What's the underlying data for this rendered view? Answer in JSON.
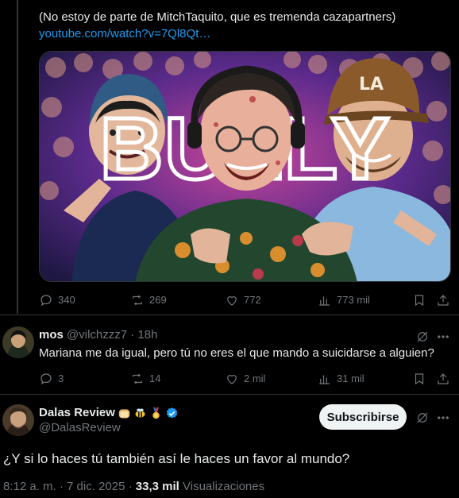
{
  "parent_tweet": {
    "text": "(No estoy de parte de MitchTaquito, que es tremenda cazapartners)",
    "link": "youtube.com/watch?v=7Ql8Qt…",
    "thumbnail_word": "BULLY",
    "actions": {
      "replies": "340",
      "retweets": "269",
      "likes": "772",
      "views": "773 mil"
    }
  },
  "reply": {
    "name": "mos",
    "handle": "@vilchzzz7",
    "separator": "·",
    "time": "18h",
    "text": "Mariana me da igual, pero tú no eres el que mando a suicidarse a alguien?",
    "actions": {
      "replies": "3",
      "retweets": "14",
      "likes": "2 mil",
      "views": "31 mil"
    }
  },
  "main_tweet": {
    "name": "Dalas Review",
    "emoji_badges": [
      "bread-emoji",
      "bee-emoji",
      "medal-emoji"
    ],
    "verified": true,
    "handle": "@DalasReview",
    "subscribe_label": "Subscribirse",
    "text": "¿Y si lo haces tú también así le haces un favor al mundo?",
    "time": "8:12 a. m.",
    "date": "7 dic. 2025",
    "separator": "·",
    "views_count": "33,3 mil",
    "views_label": "Visualizaciones"
  },
  "colors": {
    "background": "#000000",
    "text": "#e7e9ea",
    "muted": "#71767b",
    "link": "#1d9bf0",
    "divider": "#2f3336",
    "verified": "#1d9bf0",
    "button_bg": "#eff3f4"
  }
}
